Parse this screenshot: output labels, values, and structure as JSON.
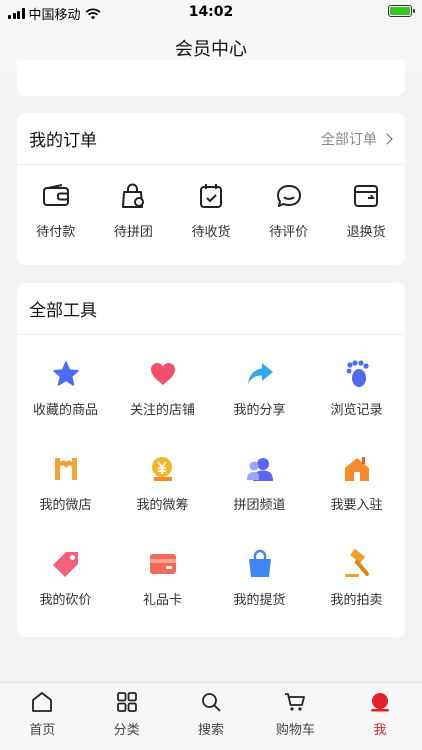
{
  "status": {
    "carrier": "中国移动",
    "time": "14:02",
    "battery_level": 1.0
  },
  "nav": {
    "title": "会员中心"
  },
  "orders": {
    "title": "我的订单",
    "all_label": "全部订单",
    "items": [
      {
        "label": "待付款",
        "icon": "wallet-icon"
      },
      {
        "label": "待拼团",
        "icon": "group-bag-icon"
      },
      {
        "label": "待收货",
        "icon": "calendar-check-icon"
      },
      {
        "label": "待评价",
        "icon": "comment-icon"
      },
      {
        "label": "退换货",
        "icon": "return-icon"
      }
    ]
  },
  "tools": {
    "title": "全部工具",
    "items": [
      {
        "label": "收藏的商品",
        "icon": "star-icon",
        "color": "#4a6cf7"
      },
      {
        "label": "关注的店铺",
        "icon": "heart-icon",
        "color": "#f0506e"
      },
      {
        "label": "我的分享",
        "icon": "share-arrow-icon",
        "color": "#2fa8f0"
      },
      {
        "label": "浏览记录",
        "icon": "footprint-icon",
        "color": "#4f6bef"
      },
      {
        "label": "我的微店",
        "icon": "shop-icon",
        "color": "#f5a23a"
      },
      {
        "label": "我的微筹",
        "icon": "yuan-coin-icon",
        "color": "#f6b42a"
      },
      {
        "label": "拼团频道",
        "icon": "group-people-icon",
        "color": "#5965f0"
      },
      {
        "label": "我要入驻",
        "icon": "house-icon",
        "color": "#f58a2c"
      },
      {
        "label": "我的砍价",
        "icon": "tag-icon",
        "color": "#f3627a"
      },
      {
        "label": "礼品卡",
        "icon": "gift-card-icon",
        "color": "#f2685a"
      },
      {
        "label": "我的提货",
        "icon": "shopping-bag-icon",
        "color": "#3f86f0"
      },
      {
        "label": "我的拍卖",
        "icon": "gavel-icon",
        "color": "#f0a128"
      }
    ]
  },
  "tabs": [
    {
      "label": "首页",
      "icon": "home-icon"
    },
    {
      "label": "分类",
      "icon": "grid-icon"
    },
    {
      "label": "搜索",
      "icon": "search-icon"
    },
    {
      "label": "购物车",
      "icon": "cart-icon"
    },
    {
      "label": "我",
      "icon": "profile-icon",
      "active": true
    }
  ]
}
